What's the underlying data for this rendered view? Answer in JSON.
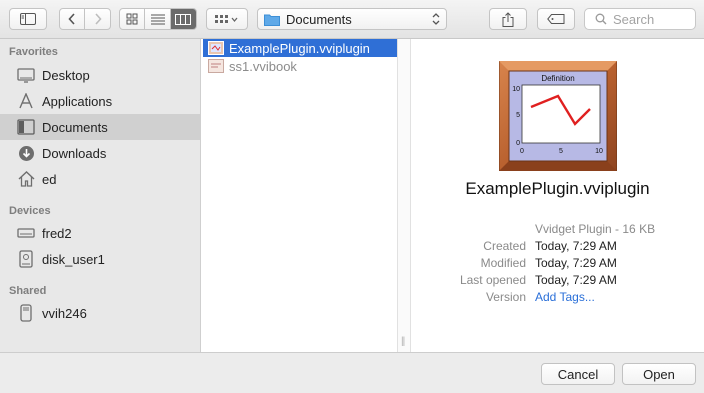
{
  "toolbar": {
    "path": {
      "label": "Documents",
      "icon": "folder-icon"
    },
    "search": {
      "placeholder": "Search"
    }
  },
  "sidebar": {
    "favorites": {
      "title": "Favorites",
      "items": [
        {
          "label": "Desktop",
          "icon": "desktop-icon"
        },
        {
          "label": "Applications",
          "icon": "applications-icon"
        },
        {
          "label": "Documents",
          "icon": "documents-icon",
          "selected": true
        },
        {
          "label": "Downloads",
          "icon": "downloads-icon"
        },
        {
          "label": "ed",
          "icon": "home-icon"
        }
      ]
    },
    "devices": {
      "title": "Devices",
      "items": [
        {
          "label": "fred2",
          "icon": "drive-icon"
        },
        {
          "label": "disk_user1",
          "icon": "disk-icon"
        }
      ]
    },
    "shared": {
      "title": "Shared",
      "items": [
        {
          "label": "vvih246",
          "icon": "server-icon"
        }
      ]
    }
  },
  "files": [
    {
      "name": "ExamplePlugin.vviplugin",
      "selected": true
    },
    {
      "name": "ss1.vvibook",
      "selected": false,
      "dimmed": true
    }
  ],
  "preview": {
    "name": "ExamplePlugin.vviplugin",
    "kind": "Vvidget Plugin - 16 KB",
    "thumbnail": {
      "title": "Definition",
      "y_ticks": [
        "10",
        "5",
        "0"
      ],
      "x_ticks": [
        "0",
        "5",
        "10"
      ]
    },
    "meta": [
      {
        "key": "Created",
        "value": "Today, 7:29 AM"
      },
      {
        "key": "Modified",
        "value": "Today, 7:29 AM"
      },
      {
        "key": "Last opened",
        "value": "Today, 7:29 AM"
      },
      {
        "key": "Version",
        "value": "Add Tags..."
      }
    ]
  },
  "buttons": {
    "cancel": "Cancel",
    "open": "Open"
  },
  "colors": {
    "selection": "#2f6fd6",
    "link": "#2a6fd8",
    "sidebar_selected": "#d0d0d0"
  }
}
